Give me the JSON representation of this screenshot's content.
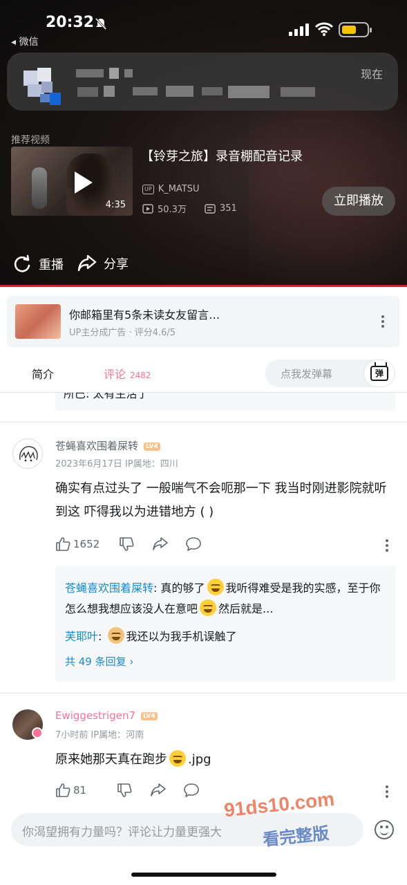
{
  "status_bar": {
    "time": "20:32",
    "back_app": "◂ 微信"
  },
  "notification": {
    "time": "现在"
  },
  "recommend": {
    "label": "推荐视频",
    "title": "【铃芽之旅】录音棚配音记录",
    "up_name": "K_MATSU",
    "views": "50.3万",
    "danmaku_count": "351",
    "duration": "4:35",
    "play_now_label": "立即播放"
  },
  "player_actions": {
    "replay_label": "重播",
    "share_label": "分享"
  },
  "ad": {
    "title": "你邮箱里有5条未读女友留言…",
    "subtitle": "UP主分成广告 · 评分4.6/5"
  },
  "tabs": {
    "intro_label": "简介",
    "comments_label": "评论",
    "comments_count": "2482",
    "danmaku_placeholder": "点我发弹幕",
    "danmaku_icon_text": "弹"
  },
  "prev_reply_fragment": "所巳: 太有生活了",
  "comments": [
    {
      "username": "苍蝇喜欢围着屎转",
      "level": "LV4",
      "meta": "2023年6月17日  IP属地：四川",
      "text": "确实有点过头了 一般喘气不会呃那一下 我当时刚进影院就听到这 吓得我以为进错地方 ( )",
      "likes": "1652",
      "replies": [
        {
          "name": "苍蝇喜欢围着屎转",
          "text_a": "真的够了",
          "text_b": "我听得难受是我的实感，至于你怎么想我想应该没人在意吧",
          "text_c": "然后就是..."
        },
        {
          "name": "芙耶叶",
          "text": "我还以为我手机误触了"
        }
      ],
      "more_replies": "共 49 条回复 ›"
    },
    {
      "username": "Ewiggestrigen7",
      "level": "LV4",
      "meta": "7小时前  IP属地：河南",
      "text_a": "原来她那天真在跑步",
      "text_b": ".jpg",
      "likes": "81"
    }
  ],
  "input": {
    "placeholder": "你渴望拥有力量吗？评论让力量更强大"
  },
  "watermark": {
    "line1": "91ds10.com",
    "line2": "看完整版"
  },
  "colors": {
    "accent_pink": "#fb7299",
    "reply_blue": "#178bcf",
    "muted": "#9499a0"
  }
}
